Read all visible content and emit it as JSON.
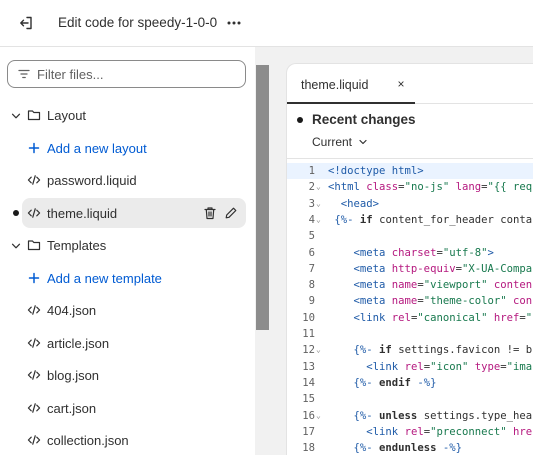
{
  "topbar": {
    "title": "Edit code for speedy-1-0-0",
    "back_icon": "exit-icon",
    "more_icon": "more-horizontal-icon"
  },
  "sidebar": {
    "filter_placeholder": "Filter files...",
    "items": [
      {
        "kind": "folder",
        "label": "Layout"
      },
      {
        "kind": "add",
        "label": "Add a new layout"
      },
      {
        "kind": "file",
        "label": "password.liquid"
      },
      {
        "kind": "file",
        "label": "theme.liquid",
        "selected": true
      },
      {
        "kind": "folder",
        "label": "Templates"
      },
      {
        "kind": "add",
        "label": "Add a new template"
      },
      {
        "kind": "file",
        "label": "404.json"
      },
      {
        "kind": "file",
        "label": "article.json"
      },
      {
        "kind": "file",
        "label": "blog.json"
      },
      {
        "kind": "file",
        "label": "cart.json"
      },
      {
        "kind": "file",
        "label": "collection.json"
      }
    ]
  },
  "editor": {
    "tab_label": "theme.liquid",
    "tab_close": "×",
    "recent_label": "Recent changes",
    "current_label": "Current",
    "active_line": 1,
    "lines": [
      {
        "n": "1",
        "fold": "",
        "html": "<span class=\"tag\">&lt;!doctype html&gt;</span>"
      },
      {
        "n": "2",
        "fold": "⌄",
        "html": "<span class=\"tag\">&lt;html</span> <span class=\"attr\">class</span>=<span class=\"str\">\"no-js\"</span> <span class=\"attr\">lang</span>=<span class=\"str\">\"{{ req</span>"
      },
      {
        "n": "3",
        "fold": "⌄",
        "html": "  <span class=\"tag\">&lt;head&gt;</span>"
      },
      {
        "n": "4",
        "fold": "⌄",
        "html": " <span class=\"liq\">{%-</span> <span class=\"kw\">if</span> content_for_header conta"
      },
      {
        "n": "5",
        "fold": "",
        "html": ""
      },
      {
        "n": "6",
        "fold": "",
        "html": "    <span class=\"tag\">&lt;meta</span> <span class=\"attr\">charset</span>=<span class=\"str\">\"utf-8\"</span><span class=\"tag\">&gt;</span>"
      },
      {
        "n": "7",
        "fold": "",
        "html": "    <span class=\"tag\">&lt;meta</span> <span class=\"attr\">http-equiv</span>=<span class=\"str\">\"X-UA-Compa</span>"
      },
      {
        "n": "8",
        "fold": "",
        "html": "    <span class=\"tag\">&lt;meta</span> <span class=\"attr\">name</span>=<span class=\"str\">\"viewport\"</span> <span class=\"attr\">conten</span>"
      },
      {
        "n": "9",
        "fold": "",
        "html": "    <span class=\"tag\">&lt;meta</span> <span class=\"attr\">name</span>=<span class=\"str\">\"theme-color\"</span> <span class=\"attr\">con</span>"
      },
      {
        "n": "10",
        "fold": "",
        "html": "    <span class=\"tag\">&lt;link</span> <span class=\"attr\">rel</span>=<span class=\"str\">\"canonical\"</span> <span class=\"attr\">href</span>=<span class=\"str\">\"</span>"
      },
      {
        "n": "11",
        "fold": "",
        "html": ""
      },
      {
        "n": "12",
        "fold": "⌄",
        "html": "    <span class=\"liq\">{%-</span> <span class=\"kw\">if</span> settings.favicon != b"
      },
      {
        "n": "13",
        "fold": "",
        "html": "      <span class=\"tag\">&lt;link</span> <span class=\"attr\">rel</span>=<span class=\"str\">\"icon\"</span> <span class=\"attr\">type</span>=<span class=\"str\">\"ima</span>"
      },
      {
        "n": "14",
        "fold": "",
        "html": "    <span class=\"liq\">{%-</span> <span class=\"kw\">endif</span> <span class=\"liq\">-%}</span>"
      },
      {
        "n": "15",
        "fold": "",
        "html": ""
      },
      {
        "n": "16",
        "fold": "⌄",
        "html": "    <span class=\"liq\">{%-</span> <span class=\"kw\">unless</span> settings.type_hea"
      },
      {
        "n": "17",
        "fold": "",
        "html": "      <span class=\"tag\">&lt;link</span> <span class=\"attr\">rel</span>=<span class=\"str\">\"preconnect\"</span> <span class=\"attr\">hre</span>"
      },
      {
        "n": "18",
        "fold": "",
        "html": "    <span class=\"liq\">{%-</span> <span class=\"kw\">endunless</span> <span class=\"liq\">-%}</span>"
      }
    ]
  },
  "colors": {
    "link": "#005bd3",
    "selected_bg": "#ebebeb",
    "active_line_bg": "#eaf3ff"
  }
}
